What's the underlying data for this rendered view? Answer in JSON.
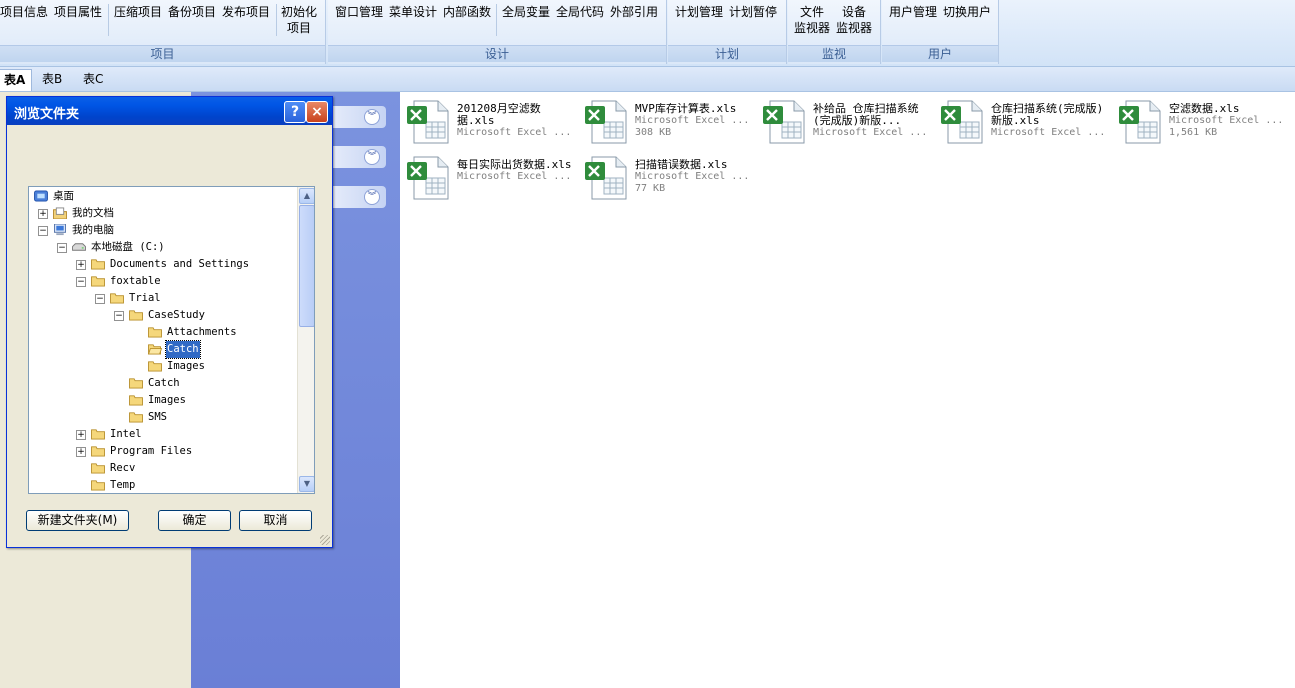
{
  "ribbon": {
    "groups": [
      {
        "label": "项目",
        "buttons": [
          "项目信息",
          "项目属性",
          "压缩项目",
          "备份项目",
          "发布项目"
        ],
        "extra": [
          "初始化",
          "项目"
        ]
      },
      {
        "label": "设计",
        "buttons": [
          "窗口管理",
          "菜单设计",
          "内部函数",
          "全局变量",
          "全局代码",
          "外部引用"
        ]
      },
      {
        "label": "计划",
        "buttons": [
          "计划管理",
          "计划暂停"
        ]
      },
      {
        "label": "监视",
        "buttons": [
          [
            "文件",
            "监视器"
          ],
          [
            "设备",
            "监视器"
          ]
        ]
      },
      {
        "label": "用户",
        "buttons": [
          "用户管理",
          "切换用户"
        ]
      }
    ]
  },
  "tabs": [
    "表A",
    "表B",
    "表C"
  ],
  "files": [
    {
      "name": "201208月空滤数据.xls",
      "type": "Microsoft Excel ...",
      "size": ""
    },
    {
      "name": "MVP库存计算表.xls",
      "type": "Microsoft Excel ...",
      "size": "308 KB"
    },
    {
      "name": "补给品  仓库扫描系统(完成版)新版...",
      "type": "Microsoft Excel ...",
      "size": ""
    },
    {
      "name": "仓库扫描系统(完成版)新版.xls",
      "type": "Microsoft Excel ...",
      "size": ""
    },
    {
      "name": "空滤数据.xls",
      "type": "Microsoft Excel ...",
      "size": "1,561 KB"
    },
    {
      "name": "每日实际出货数据.xls",
      "type": "Microsoft Excel ...",
      "size": ""
    },
    {
      "name": "扫描错误数据.xls",
      "type": "Microsoft Excel ...",
      "size": "77 KB"
    }
  ],
  "dialog": {
    "title": "浏览文件夹",
    "help": "?",
    "close": "×",
    "tree": [
      {
        "label": "桌面",
        "depth": 0,
        "toggle": "",
        "icon": "desktop-icon"
      },
      {
        "label": "我的文档",
        "depth": 1,
        "toggle": "+",
        "icon": "documents-icon"
      },
      {
        "label": "我的电脑",
        "depth": 1,
        "toggle": "−",
        "icon": "computer-icon"
      },
      {
        "label": "本地磁盘 (C:)",
        "depth": 2,
        "toggle": "−",
        "icon": "drive-icon"
      },
      {
        "label": "Documents and Settings",
        "depth": 3,
        "toggle": "+",
        "icon": "folder-icon"
      },
      {
        "label": "foxtable",
        "depth": 3,
        "toggle": "−",
        "icon": "folder-icon"
      },
      {
        "label": "Trial",
        "depth": 4,
        "toggle": "−",
        "icon": "folder-icon"
      },
      {
        "label": "CaseStudy",
        "depth": 5,
        "toggle": "−",
        "icon": "folder-icon"
      },
      {
        "label": "Attachments",
        "depth": 6,
        "toggle": "",
        "icon": "folder-icon"
      },
      {
        "label": "Catch",
        "depth": 6,
        "toggle": "",
        "icon": "folder-open-icon",
        "selected": true
      },
      {
        "label": "Images",
        "depth": 6,
        "toggle": "",
        "icon": "folder-icon"
      },
      {
        "label": "Catch",
        "depth": 5,
        "toggle": "",
        "icon": "folder-icon"
      },
      {
        "label": "Images",
        "depth": 5,
        "toggle": "",
        "icon": "folder-icon"
      },
      {
        "label": "SMS",
        "depth": 5,
        "toggle": "",
        "icon": "folder-icon"
      },
      {
        "label": "Intel",
        "depth": 3,
        "toggle": "+",
        "icon": "folder-icon"
      },
      {
        "label": "Program Files",
        "depth": 3,
        "toggle": "+",
        "icon": "folder-icon"
      },
      {
        "label": "Recv",
        "depth": 3,
        "toggle": "",
        "icon": "folder-icon"
      },
      {
        "label": "Temp",
        "depth": 3,
        "toggle": "",
        "icon": "folder-icon"
      }
    ],
    "new_folder_label": "新建文件夹(M)",
    "ok_label": "确定",
    "cancel_label": "取消"
  },
  "colors": {
    "title_bar": "#0055e5",
    "nav_pane": "#7186d9",
    "selection": "#316ac5"
  }
}
